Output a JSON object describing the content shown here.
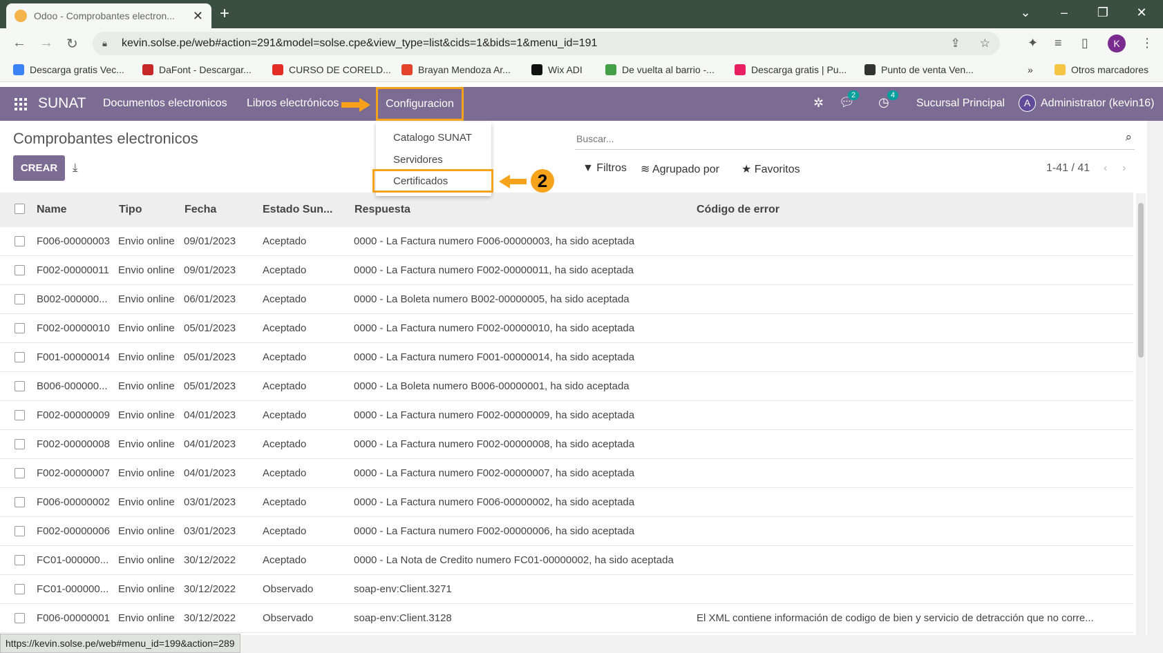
{
  "browser": {
    "tab_title": "Odoo - Comprobantes electron...",
    "tab_close": "✕",
    "new_tab": "+",
    "url": "kevin.solse.pe/web#action=291&model=solse.cpe&view_type=list&cids=1&bids=1&menu_id=191",
    "profile_initial": "K",
    "bookmarks": [
      {
        "label": "Descarga gratis Vec...",
        "color": "#3b82f6"
      },
      {
        "label": "DaFont - Descargar...",
        "color": "#c62828"
      },
      {
        "label": "CURSO DE CORELD...",
        "color": "#e52d27"
      },
      {
        "label": "Brayan Mendoza Ar...",
        "color": "#e2432a"
      },
      {
        "label": "Wix ADI",
        "color": "#111111"
      },
      {
        "label": "De vuelta al barrio -...",
        "color": "#43a047"
      },
      {
        "label": "Descarga gratis | Pu...",
        "color": "#e91e63"
      },
      {
        "label": "Punto de venta Ven...",
        "color": "#333333"
      }
    ],
    "bookmarks_more": "»",
    "other_bookmarks": "Otros marcadores",
    "status_url": "https://kevin.solse.pe/web#menu_id=199&action=289"
  },
  "navbar": {
    "brand": "SUNAT",
    "menus": [
      "Documentos electronicos",
      "Libros electrónicos",
      "Configuracion"
    ],
    "messages_badge": "2",
    "activities_badge": "4",
    "branch": "Sucursal Principal",
    "user_initial": "A",
    "user_name": "Administrator (kevin16)"
  },
  "dropdown": {
    "items": [
      "Catalogo SUNAT",
      "Servidores",
      "Certificados"
    ],
    "step_number": "2"
  },
  "control_panel": {
    "title": "Comprobantes electronicos",
    "create_label": "CREAR",
    "search_placeholder": "Buscar...",
    "filters_label": "Filtros",
    "group_by_label": "Agrupado por",
    "favorites_label": "Favoritos",
    "pager": "1-41 / 41"
  },
  "table": {
    "headers": [
      "Name",
      "Tipo",
      "Fecha",
      "Estado Sun...",
      "Respuesta",
      "Código de error"
    ],
    "rows": [
      {
        "name": "F006-00000003",
        "tipo": "Envio online",
        "fecha": "09/01/2023",
        "estado": "Aceptado",
        "respuesta": "0000 - La Factura numero F006-00000003, ha sido aceptada",
        "error": ""
      },
      {
        "name": "F002-00000011",
        "tipo": "Envio online",
        "fecha": "09/01/2023",
        "estado": "Aceptado",
        "respuesta": "0000 - La Factura numero F002-00000011, ha sido aceptada",
        "error": ""
      },
      {
        "name": "B002-000000...",
        "tipo": "Envio online",
        "fecha": "06/01/2023",
        "estado": "Aceptado",
        "respuesta": "0000 - La Boleta numero B002-00000005, ha sido aceptada",
        "error": ""
      },
      {
        "name": "F002-00000010",
        "tipo": "Envio online",
        "fecha": "05/01/2023",
        "estado": "Aceptado",
        "respuesta": "0000 - La Factura numero F002-00000010, ha sido aceptada",
        "error": ""
      },
      {
        "name": "F001-00000014",
        "tipo": "Envio online",
        "fecha": "05/01/2023",
        "estado": "Aceptado",
        "respuesta": "0000 - La Factura numero F001-00000014, ha sido aceptada",
        "error": ""
      },
      {
        "name": "B006-000000...",
        "tipo": "Envio online",
        "fecha": "05/01/2023",
        "estado": "Aceptado",
        "respuesta": "0000 - La Boleta numero B006-00000001, ha sido aceptada",
        "error": ""
      },
      {
        "name": "F002-00000009",
        "tipo": "Envio online",
        "fecha": "04/01/2023",
        "estado": "Aceptado",
        "respuesta": "0000 - La Factura numero F002-00000009, ha sido aceptada",
        "error": ""
      },
      {
        "name": "F002-00000008",
        "tipo": "Envio online",
        "fecha": "04/01/2023",
        "estado": "Aceptado",
        "respuesta": "0000 - La Factura numero F002-00000008, ha sido aceptada",
        "error": ""
      },
      {
        "name": "F002-00000007",
        "tipo": "Envio online",
        "fecha": "04/01/2023",
        "estado": "Aceptado",
        "respuesta": "0000 - La Factura numero F002-00000007, ha sido aceptada",
        "error": ""
      },
      {
        "name": "F006-00000002",
        "tipo": "Envio online",
        "fecha": "03/01/2023",
        "estado": "Aceptado",
        "respuesta": "0000 - La Factura numero F006-00000002, ha sido aceptada",
        "error": ""
      },
      {
        "name": "F002-00000006",
        "tipo": "Envio online",
        "fecha": "03/01/2023",
        "estado": "Aceptado",
        "respuesta": "0000 - La Factura numero F002-00000006, ha sido aceptada",
        "error": ""
      },
      {
        "name": "FC01-000000...",
        "tipo": "Envio online",
        "fecha": "30/12/2022",
        "estado": "Aceptado",
        "respuesta": "0000 - La Nota de Credito numero FC01-00000002, ha sido aceptada",
        "error": ""
      },
      {
        "name": "FC01-000000...",
        "tipo": "Envio online",
        "fecha": "30/12/2022",
        "estado": "Observado",
        "respuesta": "soap-env:Client.3271",
        "error": ""
      },
      {
        "name": "F006-00000001",
        "tipo": "Envio online",
        "fecha": "30/12/2022",
        "estado": "Observado",
        "respuesta": "soap-env:Client.3128",
        "error": "El XML contiene información de codigo de bien y servicio de detracción que no corre..."
      }
    ]
  },
  "colors": {
    "navbar": "#7c6b92",
    "highlight": "#f7a21b",
    "chrome": "#3a4f41"
  }
}
